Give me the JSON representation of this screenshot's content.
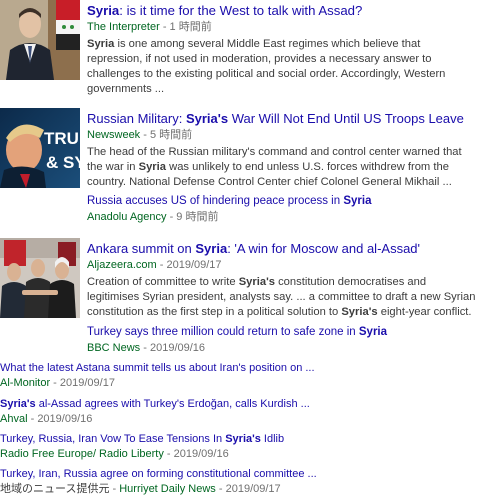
{
  "story1": {
    "title_prefix": "Syria",
    "title_rest": ": is it time for the West to talk with Assad?",
    "source": "The Interpreter",
    "time": "1 時間前",
    "snippet_bold": "Syria",
    "snippet_rest": " is one among several Middle East regimes which believe that repression, if not used in moderation, provides a necessary answer to challenges to the existing political and social order. Accordingly, Western governments ..."
  },
  "story2": {
    "title_prefix": "Russian Military: ",
    "title_bold": "Syria's",
    "title_rest": " War Will Not End Until US Troops Leave",
    "source": "Newsweek",
    "time": "5 時間前",
    "snippet_a": "The head of the Russian military's command and control center warned that the war in ",
    "snippet_bold": "Syria",
    "snippet_b": " was unlikely to end unless U.S. forces withdrew from the country. National Defense Control Center chief Colonel General Mikhail ...",
    "thumb_text_1": "TRU",
    "thumb_text_2": "& SY",
    "related_title_a": "Russia accuses US of hindering peace process in ",
    "related_title_bold": "Syria",
    "related_source": "Anadolu Agency",
    "related_time": "9 時間前"
  },
  "story3": {
    "title_prefix": "Ankara summit on ",
    "title_bold": "Syria",
    "title_rest": ": 'A win for Moscow and al-Assad'",
    "source": "Aljazeera.com",
    "date": "2019/09/17",
    "snippet_a": "Creation of committee to write ",
    "snippet_bold1": "Syria's",
    "snippet_b": " constitution democratises and legitimises Syrian president, analysts say. ... a committee to draft a new Syrian constitution as the first step in a political solution to ",
    "snippet_bold2": "Syria's",
    "snippet_c": " eight-year conflict.",
    "related_title_a": "Turkey says three million could return to safe zone in ",
    "related_title_bold": "Syria",
    "related_source": "BBC News",
    "related_date": "2019/09/16"
  },
  "more": [
    {
      "title_a": "What the latest Astana summit tells us about Iran's position on ...",
      "title_bold": "",
      "title_b": "",
      "source": "Al-Monitor",
      "date": "2019/09/17"
    },
    {
      "title_a": "",
      "title_bold": "Syria's",
      "title_b": " al-Assad agrees with Turkey's Erdoğan, calls Kurdish ...",
      "source": "Ahval",
      "date": "2019/09/16"
    },
    {
      "title_a": "Turkey, Russia, Iran Vow To Ease Tensions In ",
      "title_bold": "Syria's",
      "title_b": " Idlib",
      "source": "Radio Free Europe/ Radio Liberty",
      "date": "2019/09/16"
    },
    {
      "title_a": "Turkey, Iran, Russia agree on forming constitutional committee ...",
      "title_bold": "",
      "title_b": "",
      "source_prefix": "地域のニュース提供元",
      "source": "Hurriyet Daily News",
      "date": "2019/09/17"
    }
  ],
  "separator": " - "
}
